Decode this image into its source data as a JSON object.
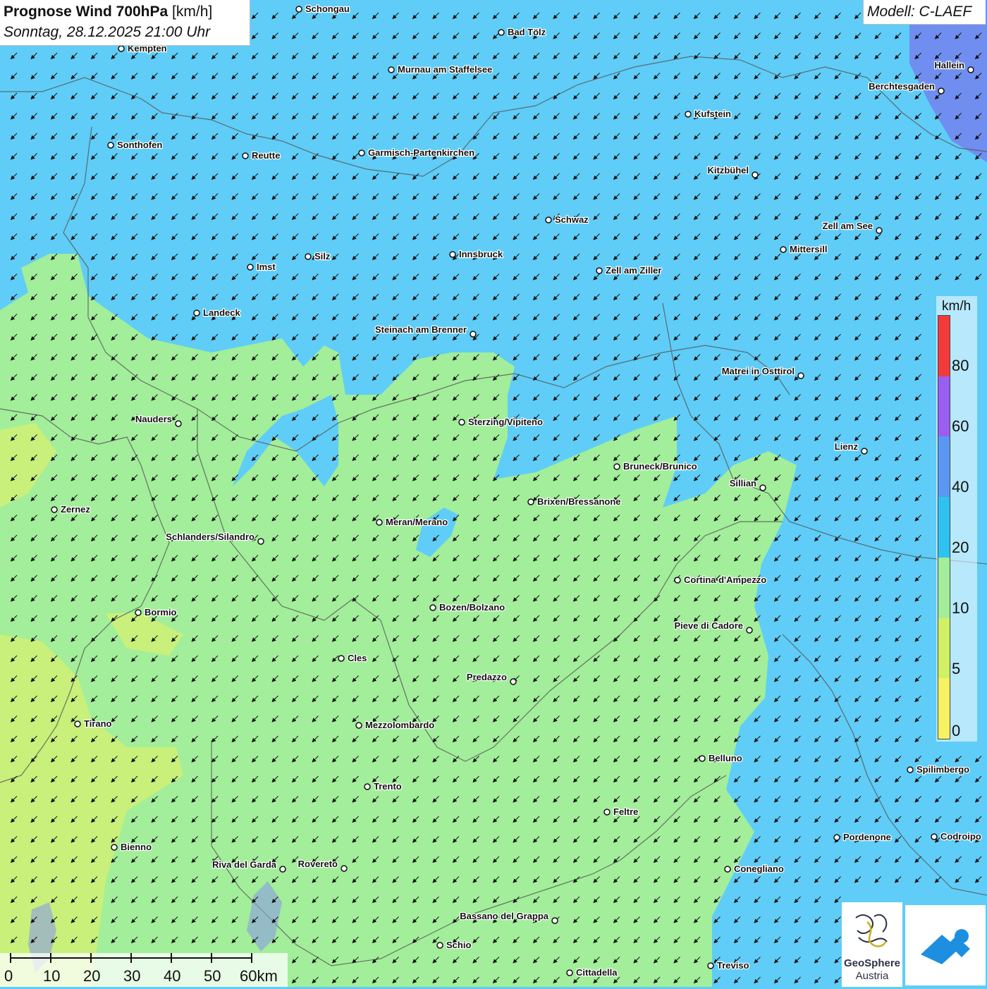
{
  "header": {
    "title_bold": "Prognose Wind 700hPa",
    "title_unit": "[km/h]",
    "datetime": "Sonntag, 28.12.2025 21:00 Uhr"
  },
  "model": {
    "label": "Modell: C-LAEF"
  },
  "legend": {
    "unit": "km/h",
    "labels": [
      "80",
      "60",
      "40",
      "20",
      "10",
      "5",
      "0"
    ],
    "colors": [
      "#f23a3a",
      "#9a5ef0",
      "#5a97f2",
      "#2ec2f2",
      "#a2ee9a",
      "#d2f064",
      "#f7f261"
    ]
  },
  "cities": [
    {
      "name": "Schongau"
    },
    {
      "name": "Bad Tölz"
    },
    {
      "name": "Kempten"
    },
    {
      "name": "Murnau am Staffelsee"
    },
    {
      "name": "Hallein"
    },
    {
      "name": "Berchtesgaden"
    },
    {
      "name": "Kufstein"
    },
    {
      "name": "Sonthofen"
    },
    {
      "name": "Reutte"
    },
    {
      "name": "Garmisch-Partenkirchen"
    },
    {
      "name": "Kitzbühel"
    },
    {
      "name": "Schwaz"
    },
    {
      "name": "Zell am See"
    },
    {
      "name": "Mittersill"
    },
    {
      "name": "Innsbruck"
    },
    {
      "name": "Imst"
    },
    {
      "name": "Silz"
    },
    {
      "name": "Zell am Ziller"
    },
    {
      "name": "Landeck"
    },
    {
      "name": "Steinach am Brenner"
    },
    {
      "name": "Matrei in Osttirol"
    },
    {
      "name": "Nauders"
    },
    {
      "name": "Sterzing/Vipiteno"
    },
    {
      "name": "Lienz"
    },
    {
      "name": "Bruneck/Brunico"
    },
    {
      "name": "Sillian"
    },
    {
      "name": "Zernez"
    },
    {
      "name": "Brixen/Bressanone"
    },
    {
      "name": "Meran/Merano"
    },
    {
      "name": "Schlanders/Silandro"
    },
    {
      "name": "Cortina d'Ampezzo"
    },
    {
      "name": "Bozen/Bolzano"
    },
    {
      "name": "Bormio"
    },
    {
      "name": "Pieve di Cadore"
    },
    {
      "name": "Cles"
    },
    {
      "name": "Predazzo"
    },
    {
      "name": "Tirano"
    },
    {
      "name": "Mezzolombardo"
    },
    {
      "name": "Belluno"
    },
    {
      "name": "Spilimbergo"
    },
    {
      "name": "Trento"
    },
    {
      "name": "Feltre"
    },
    {
      "name": "Pordenone"
    },
    {
      "name": "Codroipo"
    },
    {
      "name": "Bienno"
    },
    {
      "name": "Riva del Garda"
    },
    {
      "name": "Rovereto"
    },
    {
      "name": "Conegliano"
    },
    {
      "name": "Bassano del Grappa"
    },
    {
      "name": "Schio"
    },
    {
      "name": "Treviso"
    },
    {
      "name": "Cittadella"
    }
  ],
  "scale": {
    "labels": [
      "0",
      "10",
      "20",
      "30",
      "40",
      "50",
      "60km"
    ]
  },
  "logos": {
    "geosphere_line1": "GeoSphere",
    "geosphere_line2": "Austria"
  },
  "wind": {
    "direction": "from north-east",
    "arrow_icon": "wind-arrow-icon"
  }
}
